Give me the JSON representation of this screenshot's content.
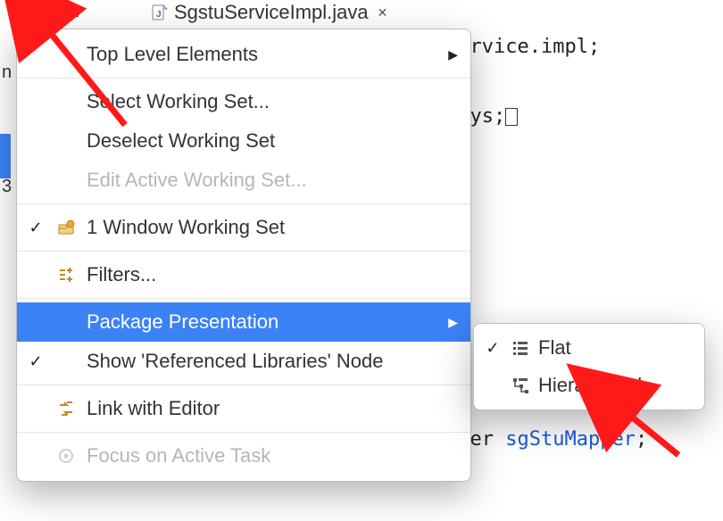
{
  "toolbar": {
    "tab_file": "SgstuServiceImpl.java"
  },
  "code": {
    "line1_tail": "service.impl",
    "line2_tail": "rays",
    "line_bottom_pre": "pper ",
    "line_bottom_id": "sgStuMapper"
  },
  "menu": {
    "top_level": "Top Level Elements",
    "select_ws": "Select Working Set...",
    "deselect_ws": "Deselect Working Set",
    "edit_ws": "Edit Active Working Set...",
    "window_ws": "1 Window Working Set",
    "filters": "Filters...",
    "pkg_present": "Package Presentation",
    "show_ref": "Show 'Referenced Libraries' Node",
    "link_editor": "Link with Editor",
    "focus_task": "Focus on Active Task"
  },
  "submenu": {
    "flat": "Flat",
    "hier": "Hierarchical"
  }
}
